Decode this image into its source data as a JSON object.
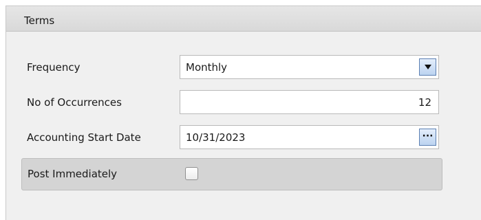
{
  "panel": {
    "title": "Terms"
  },
  "frequency": {
    "label": "Frequency",
    "value": "Monthly"
  },
  "occurrences": {
    "label": "No of Occurrences",
    "value": "12"
  },
  "start_date": {
    "label": "Accounting Start Date",
    "value": "10/31/2023",
    "button_label": "···"
  },
  "post_immediately": {
    "label": "Post Immediately",
    "checked": false
  },
  "icons": {
    "dropdown": "chevron-down-icon",
    "date_picker": "ellipsis-icon"
  },
  "colors": {
    "button_border": "#5b7fb2",
    "button_fill": "#bcd3f0"
  }
}
